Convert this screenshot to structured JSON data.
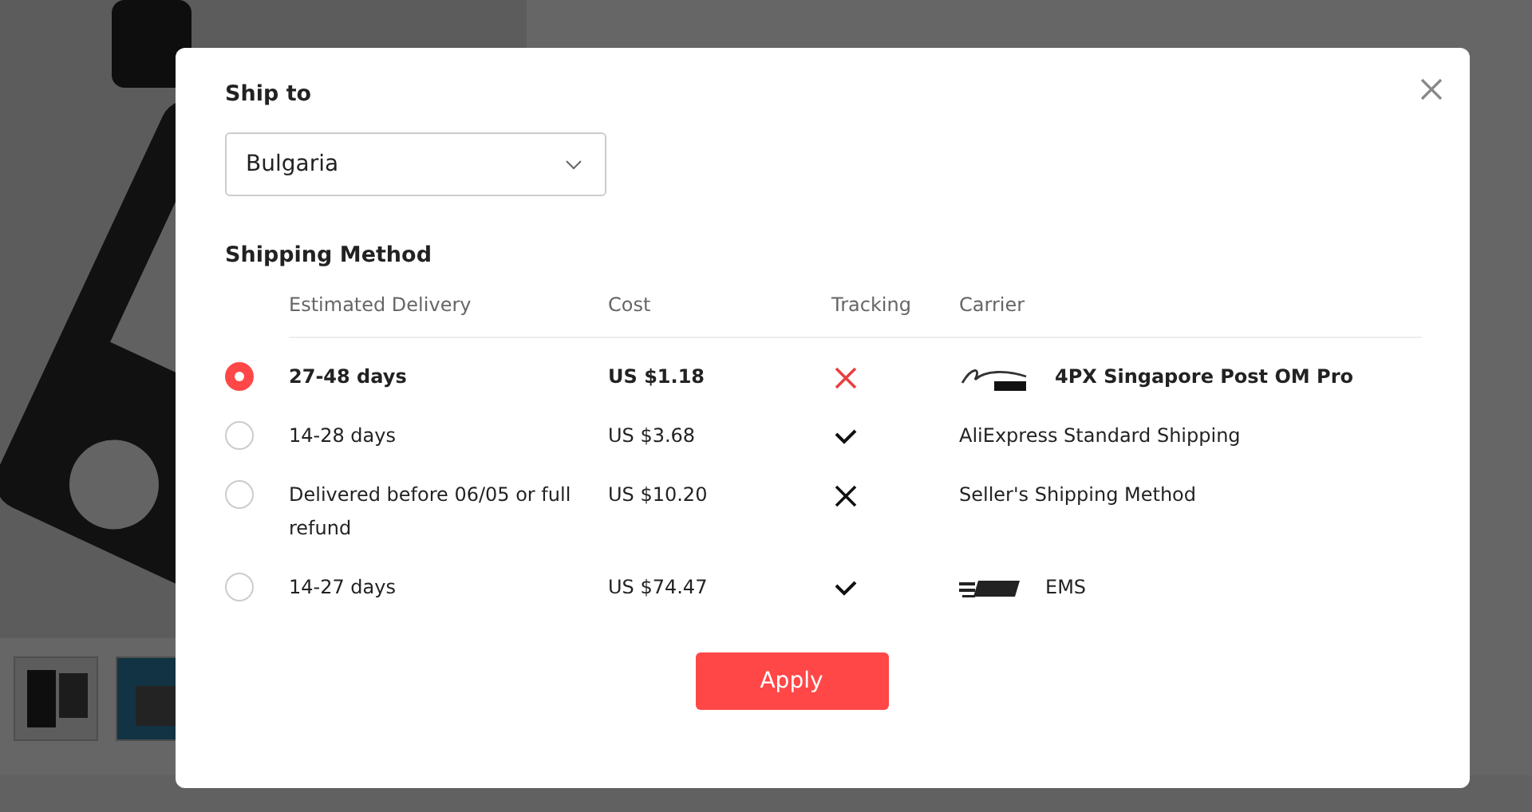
{
  "dialog": {
    "title": "Ship to",
    "country": {
      "value": "Bulgaria"
    },
    "section_title": "Shipping Method",
    "columns": [
      "Estimated Delivery",
      "Cost",
      "Tracking",
      "Carrier"
    ],
    "rows": [
      {
        "selected": true,
        "delivery": "27-48 days",
        "cost": "US $1.18",
        "tracking": false,
        "carrier": "4PX Singapore Post OM Pro",
        "kind": "singpost"
      },
      {
        "selected": false,
        "delivery": "14-28 days",
        "cost": "US $3.68",
        "tracking": true,
        "carrier": "AliExpress Standard Shipping",
        "kind": "plain"
      },
      {
        "selected": false,
        "delivery": "Delivered before 06/05 or full refund",
        "cost": "US $10.20",
        "tracking": false,
        "carrier": "Seller's Shipping Method",
        "kind": "plain"
      },
      {
        "selected": false,
        "delivery": "14-27 days",
        "cost": "US $74.47",
        "tracking": true,
        "carrier": "EMS",
        "kind": "ems"
      }
    ],
    "apply_button": "Apply"
  }
}
